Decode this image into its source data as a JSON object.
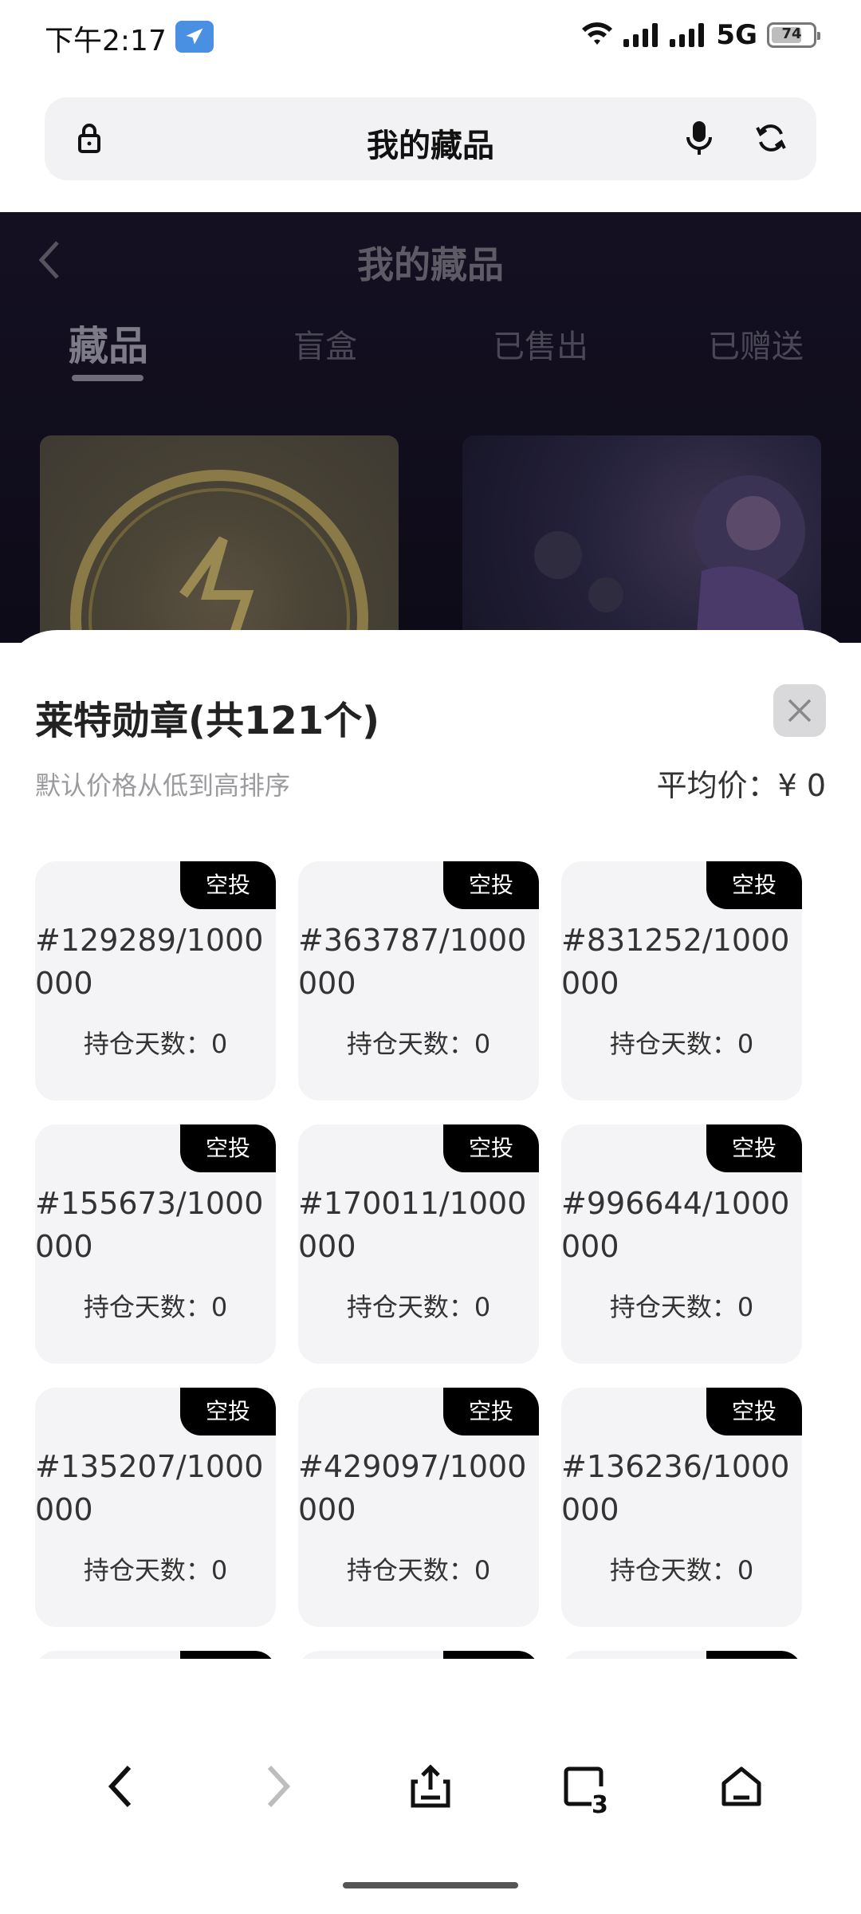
{
  "status_bar": {
    "time": "下午2:17",
    "network": "5G",
    "battery": "74",
    "battery_level": 0.74
  },
  "address_bar": {
    "title": "我的藏品"
  },
  "background_page": {
    "title": "我的藏品",
    "tabs": [
      "藏品",
      "盲盒",
      "已售出",
      "已赠送"
    ],
    "active_tab": 0
  },
  "sheet": {
    "title": "莱特勋章(共121个)",
    "sort_note": "默认价格从低到高排序",
    "avg_price": "平均价：¥ 0",
    "items": [
      {
        "badge": "空投",
        "serial": "#129289/1000000",
        "hold": "持仓天数：0"
      },
      {
        "badge": "空投",
        "serial": "#363787/1000000",
        "hold": "持仓天数：0"
      },
      {
        "badge": "空投",
        "serial": "#831252/1000000",
        "hold": "持仓天数：0"
      },
      {
        "badge": "空投",
        "serial": "#155673/1000000",
        "hold": "持仓天数：0"
      },
      {
        "badge": "空投",
        "serial": "#170011/1000000",
        "hold": "持仓天数：0"
      },
      {
        "badge": "空投",
        "serial": "#996644/1000000",
        "hold": "持仓天数：0"
      },
      {
        "badge": "空投",
        "serial": "#135207/1000000",
        "hold": "持仓天数：0"
      },
      {
        "badge": "空投",
        "serial": "#429097/1000000",
        "hold": "持仓天数：0"
      },
      {
        "badge": "空投",
        "serial": "#136236/1000000",
        "hold": "持仓天数：0"
      }
    ]
  },
  "bottom_nav": {
    "tabs_count": "3"
  },
  "colors": {
    "badge_bg": "#000000",
    "card_bg": "#f4f4f6",
    "location_badge": "#4a90e2"
  }
}
